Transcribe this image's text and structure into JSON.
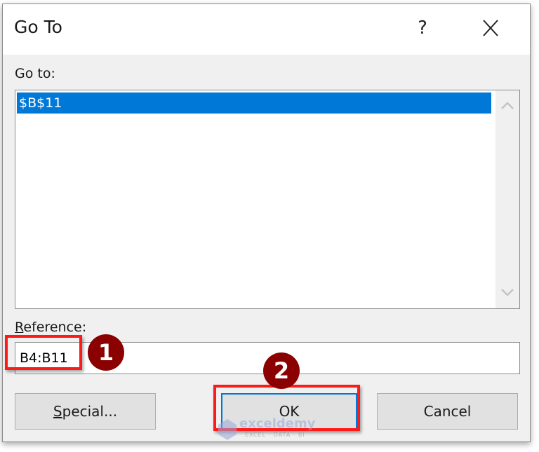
{
  "dialog": {
    "title": "Go To",
    "help_label": "?",
    "close_icon": "close-icon"
  },
  "goto": {
    "label": "Go to:",
    "items": [
      {
        "label": "$B$11",
        "selected": true
      }
    ]
  },
  "reference": {
    "label_accel": "R",
    "label_rest": "eference:",
    "value": "B4:B11"
  },
  "buttons": {
    "special_accel": "S",
    "special_rest": "pecial...",
    "ok": "OK",
    "cancel": "Cancel"
  },
  "annotations": {
    "step1": "1",
    "step2": "2",
    "highlight_color": "#ff1a1a",
    "badge_color": "#8b0000"
  },
  "watermark": {
    "brand": "exceldemy",
    "tagline": "EXCEL · DATA · BI"
  },
  "colors": {
    "selection": "#0078d7",
    "dialog_bg": "#f0f0f0"
  }
}
